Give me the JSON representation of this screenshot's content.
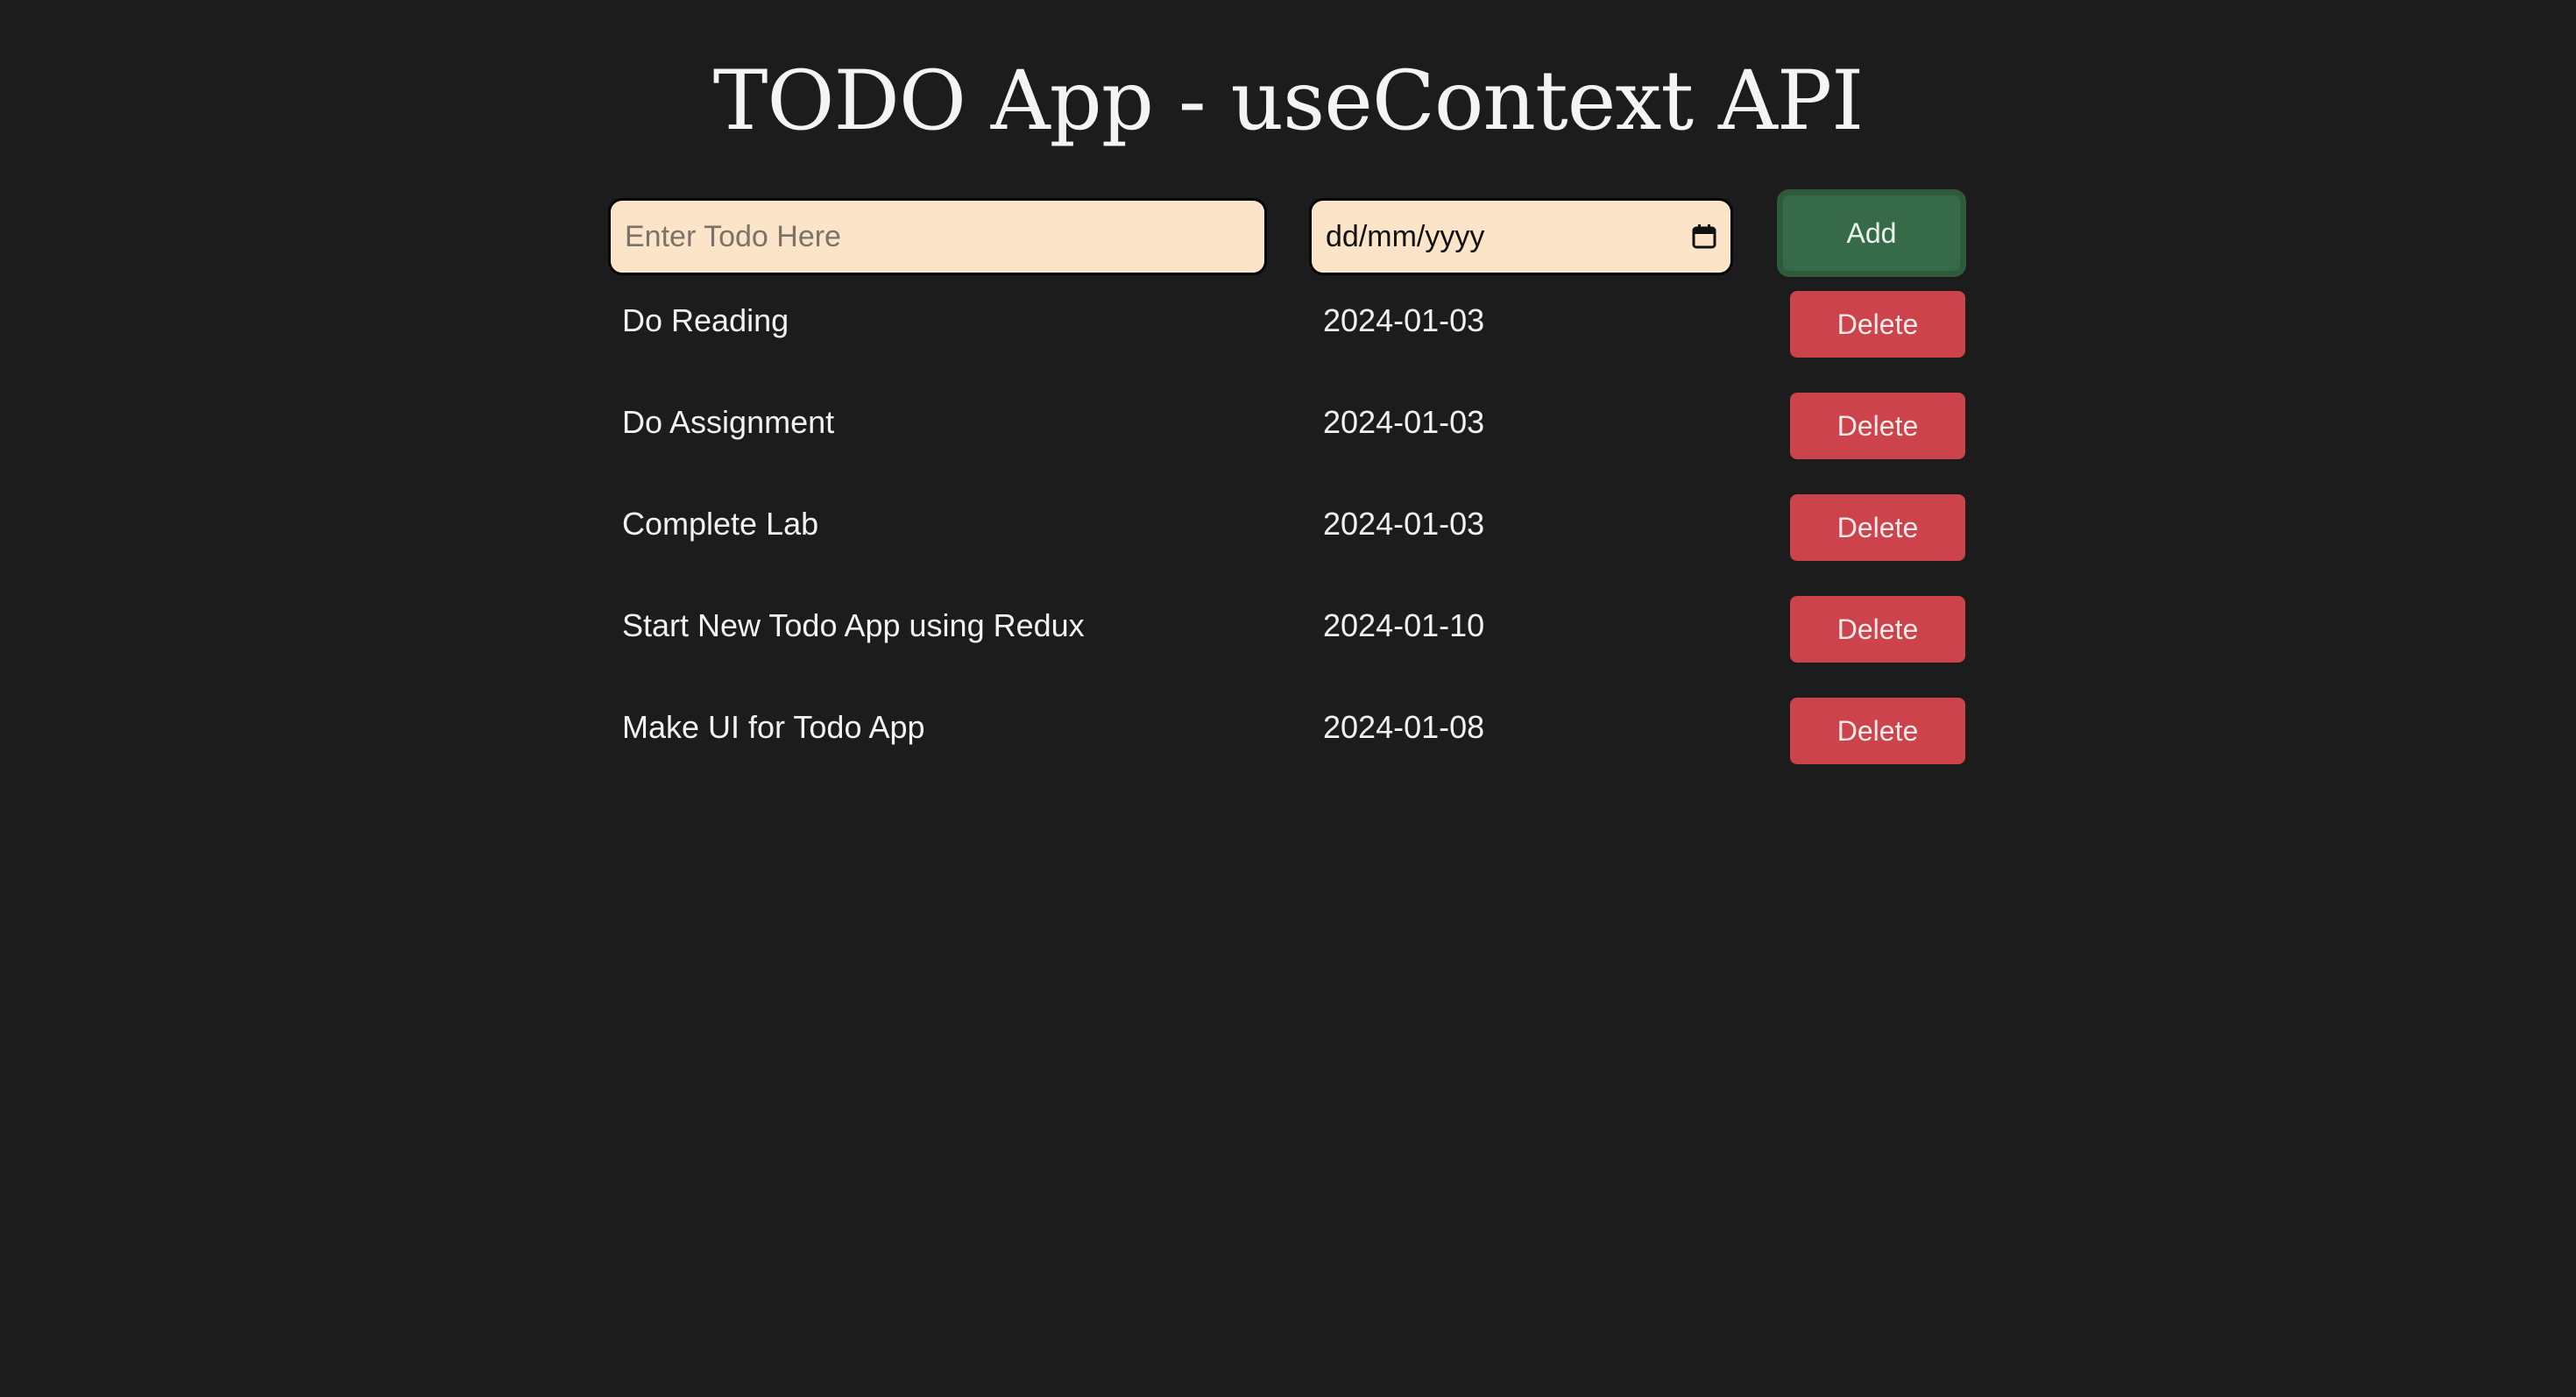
{
  "header": {
    "title": "TODO App - useContext API"
  },
  "form": {
    "todo_placeholder": "Enter Todo Here",
    "todo_value": "",
    "date_placeholder": "dd/mm/yyyy",
    "add_label": "Add"
  },
  "todos": [
    {
      "name": "Do Reading",
      "date": "2024-01-03",
      "delete_label": "Delete"
    },
    {
      "name": "Do Assignment",
      "date": "2024-01-03",
      "delete_label": "Delete"
    },
    {
      "name": "Complete Lab",
      "date": "2024-01-03",
      "delete_label": "Delete"
    },
    {
      "name": "Start New Todo App using Redux",
      "date": "2024-01-10",
      "delete_label": "Delete"
    },
    {
      "name": "Make UI for Todo App",
      "date": "2024-01-08",
      "delete_label": "Delete"
    }
  ],
  "colors": {
    "background": "#1c1c1c",
    "input_bg": "#fce4c8",
    "add_button": "#366a48",
    "delete_button": "#cc434c"
  },
  "icons": {
    "date_picker": "calendar-icon"
  }
}
